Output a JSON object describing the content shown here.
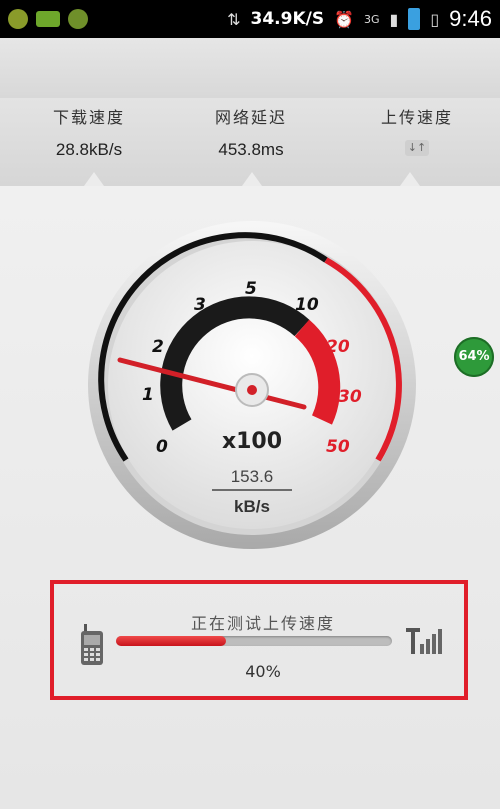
{
  "status_bar": {
    "net_speed": "34.9K/S",
    "network_type": "3G",
    "time": "9:46"
  },
  "stats": {
    "download_label": "下载速度",
    "download_value": "28.8kB/s",
    "latency_label": "网络延迟",
    "latency_value": "453.8ms",
    "upload_label": "上传速度",
    "upload_value": "↓↑"
  },
  "gauge": {
    "ticks": [
      "0",
      "1",
      "2",
      "3",
      "5",
      "10",
      "20",
      "30",
      "50"
    ],
    "multiplier": "x100",
    "speed_value": "153.6",
    "speed_unit": "kB/s"
  },
  "badge": {
    "text": "64%"
  },
  "progress": {
    "title": "正在测试上传速度",
    "percent_label": "40%",
    "fraction": 0.4
  },
  "colors": {
    "accent_red": "#e01e2a",
    "badge_green": "#2e9a3a"
  }
}
